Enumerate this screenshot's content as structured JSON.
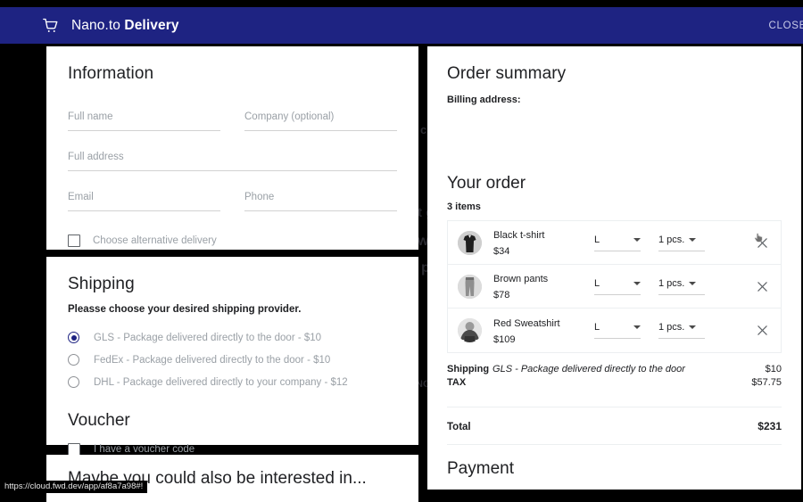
{
  "header": {
    "cart_icon": "shopping-cart-icon",
    "brand_light": "Nano.to",
    "brand_bold": "Delivery",
    "close_label": "CLOSE",
    "bar_color": "#1e2382"
  },
  "background_ghost_text": [
    "c",
    "t g",
    "w",
    "p",
    "NC"
  ],
  "information": {
    "title": "Information",
    "fields": {
      "full_name": {
        "placeholder": "Full name",
        "value": ""
      },
      "company": {
        "placeholder": "Company (optional)",
        "value": ""
      },
      "full_address": {
        "placeholder": "Full address",
        "value": ""
      },
      "email": {
        "placeholder": "Email",
        "value": ""
      },
      "phone": {
        "placeholder": "Phone",
        "value": ""
      }
    },
    "alt_delivery_label": "Choose alternative delivery",
    "alt_delivery_checked": false
  },
  "shipping": {
    "title": "Shipping",
    "subtitle": "Pleasse choose your desired shipping provider.",
    "options": [
      {
        "label": "GLS - Package delivered directly to the door - $10",
        "selected": true
      },
      {
        "label": "FedEx - Package delivered directly to the door - $10",
        "selected": false
      },
      {
        "label": "DHL - Package delivered directly to your company - $12",
        "selected": false
      }
    ]
  },
  "voucher": {
    "title": "Voucher",
    "checkbox_label": "I have a voucher code",
    "checked": false
  },
  "interested": {
    "title": "Maybe you could also be interested in..."
  },
  "order_summary": {
    "title": "Order summary",
    "billing_label": "Billing address:",
    "your_order_title": "Your order",
    "items_count": "3 items",
    "items": [
      {
        "name": "Black t-shirt",
        "price": "$34",
        "size": "L",
        "qty": "1 pcs.",
        "remove_icon": "close-x-icon",
        "hovered": true
      },
      {
        "name": "Brown pants",
        "price": "$78",
        "size": "L",
        "qty": "1 pcs.",
        "remove_icon": "close-x-icon",
        "hovered": false
      },
      {
        "name": "Red Sweatshirt",
        "price": "$109",
        "size": "L",
        "qty": "1 pcs.",
        "remove_icon": "close-x-icon",
        "hovered": false
      }
    ],
    "shipping_label": "Shipping",
    "shipping_method": "GLS - Package delivered directly to the door",
    "shipping_amount": "$10",
    "tax_label": "TAX",
    "tax_amount": "$57.75",
    "total_label": "Total",
    "total_amount": "$231",
    "payment_title": "Payment"
  },
  "status_bar": {
    "url": "https://cloud.fwd.dev/app/af8a7a98#!"
  }
}
